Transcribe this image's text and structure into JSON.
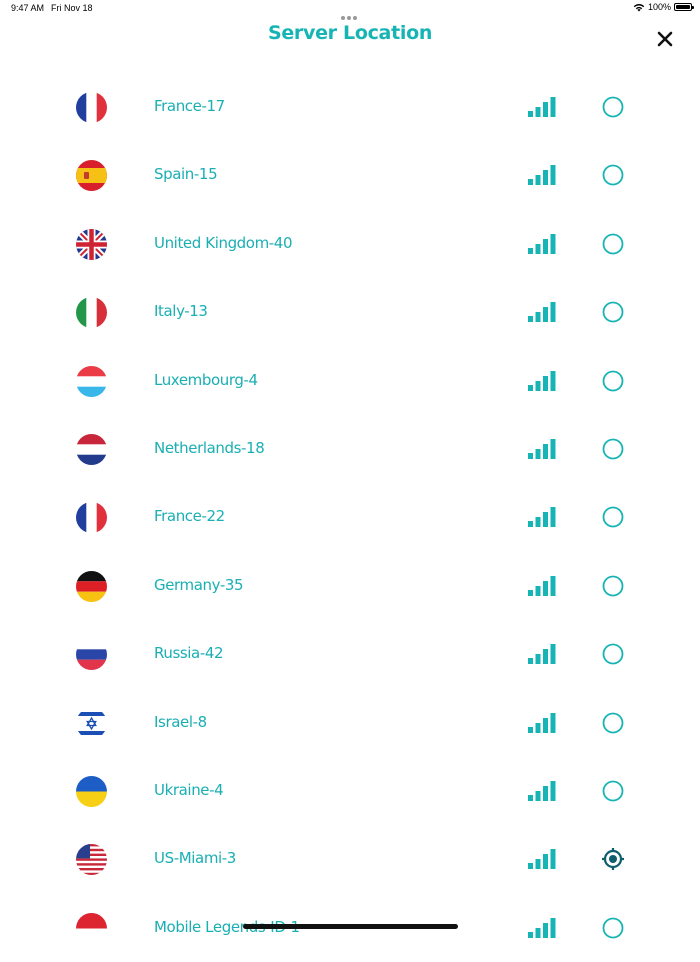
{
  "status_bar": {
    "time": "9:47 AM",
    "date": "Fri Nov 18",
    "battery": "100%",
    "wifi_icon": "wifi-icon",
    "battery_icon": "battery-icon"
  },
  "header": {
    "title": "Server Location",
    "close_icon": "close-icon"
  },
  "colors": {
    "accent": "#17b4b5",
    "selected_icon": "#0d5f6b",
    "text": "#1aafb3"
  },
  "servers": [
    {
      "name": "France-17",
      "flag": "france-flag-icon",
      "signal_bars": 4,
      "selected": false
    },
    {
      "name": "Spain-15",
      "flag": "spain-flag-icon",
      "signal_bars": 4,
      "selected": false
    },
    {
      "name": "United Kingdom-40",
      "flag": "uk-flag-icon",
      "signal_bars": 4,
      "selected": false
    },
    {
      "name": "Italy-13",
      "flag": "italy-flag-icon",
      "signal_bars": 4,
      "selected": false
    },
    {
      "name": "Luxembourg-4",
      "flag": "luxembourg-flag-icon",
      "signal_bars": 4,
      "selected": false
    },
    {
      "name": "Netherlands-18",
      "flag": "netherlands-flag-icon",
      "signal_bars": 4,
      "selected": false
    },
    {
      "name": "France-22",
      "flag": "france-flag-icon",
      "signal_bars": 4,
      "selected": false
    },
    {
      "name": "Germany-35",
      "flag": "germany-flag-icon",
      "signal_bars": 4,
      "selected": false
    },
    {
      "name": "Russia-42",
      "flag": "russia-flag-icon",
      "signal_bars": 4,
      "selected": false
    },
    {
      "name": "Israel-8",
      "flag": "israel-flag-icon",
      "signal_bars": 4,
      "selected": false
    },
    {
      "name": "Ukraine-4",
      "flag": "ukraine-flag-icon",
      "signal_bars": 4,
      "selected": false
    },
    {
      "name": "US-Miami-3",
      "flag": "usa-flag-icon",
      "signal_bars": 4,
      "selected": true
    },
    {
      "name": "Mobile Legends-ID-1",
      "flag": "indonesia-flag-icon",
      "signal_bars": 4,
      "selected": false
    }
  ]
}
